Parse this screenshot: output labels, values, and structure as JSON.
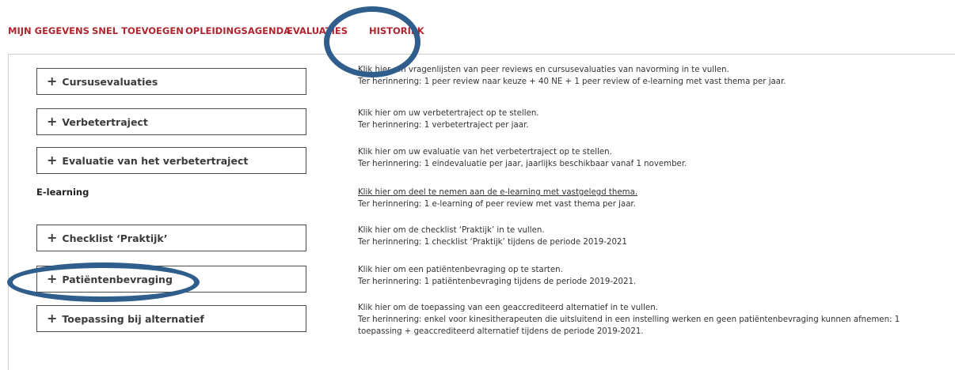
{
  "nav": {
    "items": [
      "MIJN GEGEVENS",
      "SNEL TOEVOEGEN",
      "OPLEIDINGSAGENDA",
      "EVALUATIES",
      "HISTORIEK"
    ]
  },
  "rows": [
    {
      "button_label": "Cursusevaluaties",
      "line1": "Klik hier om vragenlijsten van peer reviews en cursusevaluaties van navorming in te vullen.",
      "line2": "Ter herinnering: 1 peer review naar keuze + 40 NE + 1 peer review of e-learning met vast thema per jaar."
    },
    {
      "button_label": "Verbetertraject",
      "line1": "Klik hier om uw verbetertraject op te stellen.",
      "line2": "Ter herinnering: 1 verbetertraject per jaar."
    },
    {
      "button_label": "Evaluatie van het verbetertraject",
      "line1": "Klik hier om uw evaluatie van het verbetertraject op te stellen.",
      "line2": "Ter herinnering: 1 eindevaluatie per jaar, jaarlijks beschikbaar vanaf 1 november."
    },
    {
      "section_label": "E-learning",
      "link_text": "Klik hier om deel te nemen aan de e-learning met vastgelegd thema.",
      "line2": "Ter herinnering: 1 e-learning of peer review met vast thema per jaar."
    },
    {
      "button_label": "Checklist ‘Praktijk’",
      "line1": "Klik hier om de checklist ‘Praktijk’ in te vullen.",
      "line2": "Ter herinnering: 1 checklist ‘Praktijk’ tijdens de periode 2019-2021"
    },
    {
      "button_label": "Patiëntenbevraging",
      "line1": "Klik hier om een patiëntenbevraging op te starten.",
      "line2": "Ter herinnering: 1 patiëntenbevraging tijdens de periode 2019-2021."
    },
    {
      "button_label": "Toepassing bij alternatief",
      "line1": "Klik hier om de toepassing van een geaccrediteerd alternatief in te vullen.",
      "line2": "Ter herinnering: enkel voor kinesitherapeuten die uitsluitend in een instelling werken en geen patiëntenbevraging kunnen afnemen: 1",
      "line3": "toepassing + geaccrediteerd alternatief tijdens de periode 2019-2021."
    }
  ],
  "annotation_color": "#2f5d8c"
}
